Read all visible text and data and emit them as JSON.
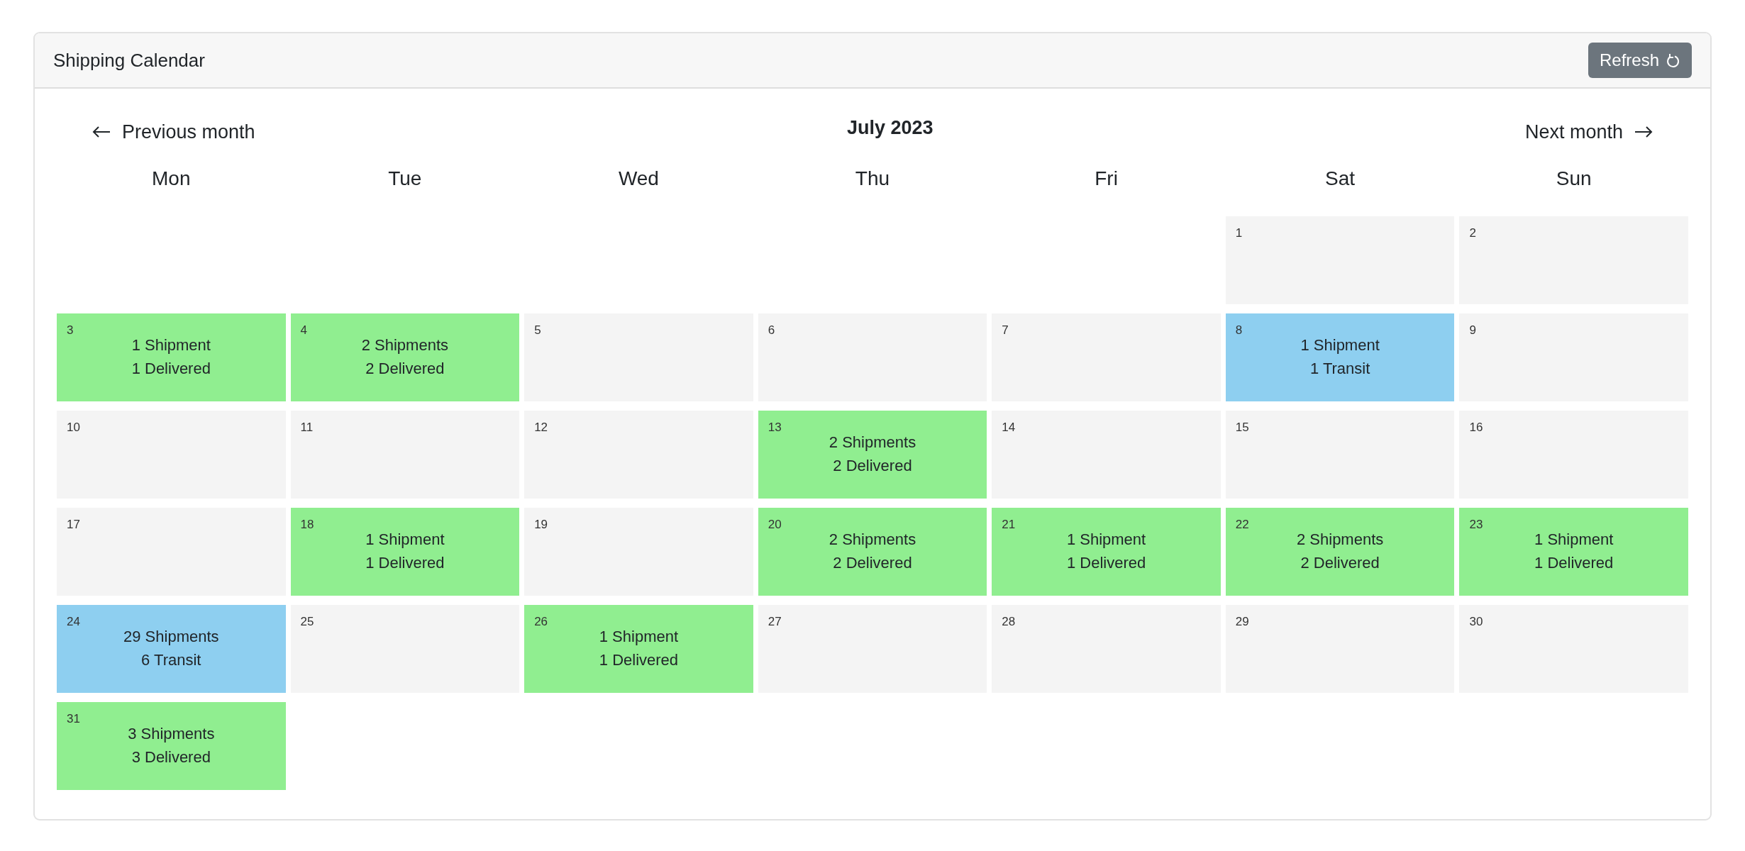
{
  "card": {
    "title": "Shipping Calendar",
    "refresh_button": "Refresh"
  },
  "nav": {
    "previous": "Previous month",
    "month": "July 2023",
    "next": "Next month"
  },
  "weekdays": [
    "Mon",
    "Tue",
    "Wed",
    "Thu",
    "Fri",
    "Sat",
    "Sun"
  ],
  "weeks": [
    [
      {
        "kind": "blank"
      },
      {
        "kind": "blank"
      },
      {
        "kind": "blank"
      },
      {
        "kind": "blank"
      },
      {
        "kind": "blank"
      },
      {
        "kind": "day",
        "day": "1",
        "color": "#f4f4f4"
      },
      {
        "kind": "day",
        "day": "2",
        "color": "#f4f4f4"
      }
    ],
    [
      {
        "kind": "day",
        "day": "3",
        "color": "#90ee90",
        "lines": [
          "1 Shipment",
          "1 Delivered"
        ]
      },
      {
        "kind": "day",
        "day": "4",
        "color": "#90ee90",
        "lines": [
          "2 Shipments",
          "2 Delivered"
        ]
      },
      {
        "kind": "day",
        "day": "5",
        "color": "#f4f4f4"
      },
      {
        "kind": "day",
        "day": "6",
        "color": "#f4f4f4"
      },
      {
        "kind": "day",
        "day": "7",
        "color": "#f4f4f4"
      },
      {
        "kind": "day",
        "day": "8",
        "color": "#8ecff0",
        "lines": [
          "1 Shipment",
          "1 Transit"
        ]
      },
      {
        "kind": "day",
        "day": "9",
        "color": "#f4f4f4"
      }
    ],
    [
      {
        "kind": "day",
        "day": "10",
        "color": "#f4f4f4"
      },
      {
        "kind": "day",
        "day": "11",
        "color": "#f4f4f4"
      },
      {
        "kind": "day",
        "day": "12",
        "color": "#f4f4f4"
      },
      {
        "kind": "day",
        "day": "13",
        "color": "#90ee90",
        "lines": [
          "2 Shipments",
          "2 Delivered"
        ]
      },
      {
        "kind": "day",
        "day": "14",
        "color": "#f4f4f4"
      },
      {
        "kind": "day",
        "day": "15",
        "color": "#f4f4f4"
      },
      {
        "kind": "day",
        "day": "16",
        "color": "#f4f4f4"
      }
    ],
    [
      {
        "kind": "day",
        "day": "17",
        "color": "#f4f4f4"
      },
      {
        "kind": "day",
        "day": "18",
        "color": "#90ee90",
        "lines": [
          "1 Shipment",
          "1 Delivered"
        ]
      },
      {
        "kind": "day",
        "day": "19",
        "color": "#f4f4f4"
      },
      {
        "kind": "day",
        "day": "20",
        "color": "#90ee90",
        "lines": [
          "2 Shipments",
          "2 Delivered"
        ]
      },
      {
        "kind": "day",
        "day": "21",
        "color": "#90ee90",
        "lines": [
          "1 Shipment",
          "1 Delivered"
        ]
      },
      {
        "kind": "day",
        "day": "22",
        "color": "#90ee90",
        "lines": [
          "2 Shipments",
          "2 Delivered"
        ]
      },
      {
        "kind": "day",
        "day": "23",
        "color": "#90ee90",
        "lines": [
          "1 Shipment",
          "1 Delivered"
        ]
      }
    ],
    [
      {
        "kind": "day",
        "day": "24",
        "color": "#8ecff0",
        "lines": [
          "29 Shipments",
          "6 Transit"
        ]
      },
      {
        "kind": "day",
        "day": "25",
        "color": "#f4f4f4"
      },
      {
        "kind": "day",
        "day": "26",
        "color": "#90ee90",
        "lines": [
          "1 Shipment",
          "1 Delivered"
        ]
      },
      {
        "kind": "day",
        "day": "27",
        "color": "#f4f4f4"
      },
      {
        "kind": "day",
        "day": "28",
        "color": "#f4f4f4"
      },
      {
        "kind": "day",
        "day": "29",
        "color": "#f4f4f4"
      },
      {
        "kind": "day",
        "day": "30",
        "color": "#f4f4f4"
      }
    ],
    [
      {
        "kind": "day",
        "day": "31",
        "color": "#90ee90",
        "lines": [
          "3 Shipments",
          "3 Delivered"
        ]
      }
    ]
  ]
}
